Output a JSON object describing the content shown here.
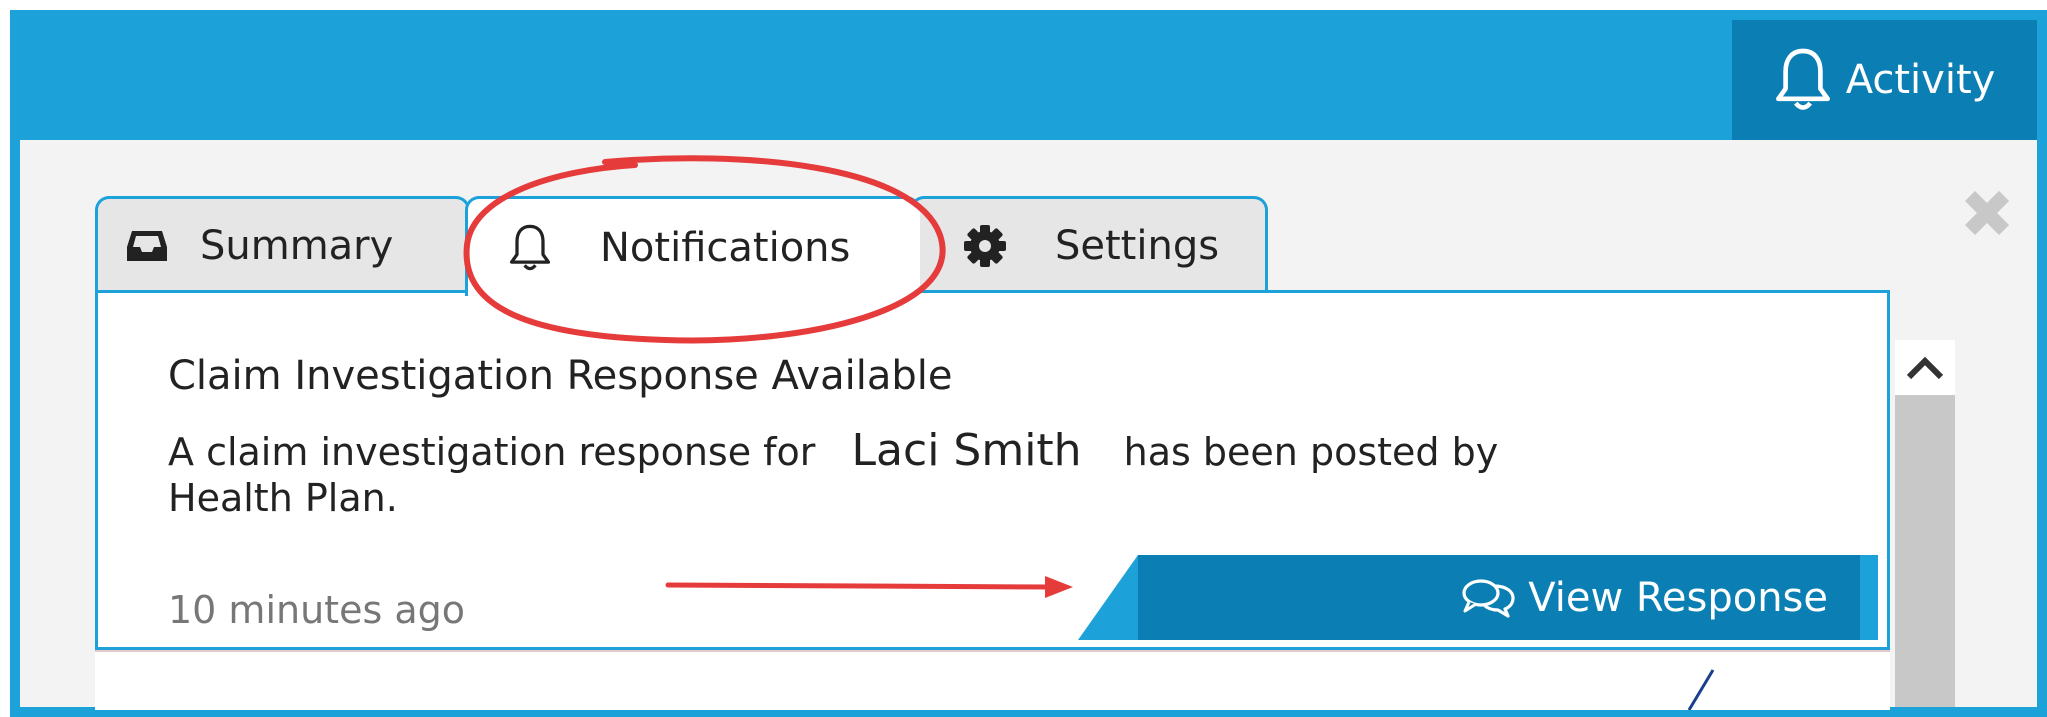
{
  "header": {
    "activity_label": "Activity",
    "activity_icon": "bell-icon"
  },
  "close_icon": "close-icon",
  "tabs": [
    {
      "label": "Summary",
      "icon": "inbox-icon"
    },
    {
      "label": "Notifications",
      "icon": "bell-icon",
      "active": true
    },
    {
      "label": "Settings",
      "icon": "gear-icon"
    }
  ],
  "notification": {
    "title": "Claim Investigation Response Available",
    "body_prefix": "A claim investigation response for",
    "patient_name": "Laci Smith",
    "body_suffix": "has been posted by Health Plan.",
    "time": "10 minutes ago",
    "action_label": "View Response",
    "action_icon": "chat-icon"
  },
  "colors": {
    "brand": "#1da1d9",
    "brand_dark": "#0b7fb4",
    "annotation": "#e63b3b"
  }
}
